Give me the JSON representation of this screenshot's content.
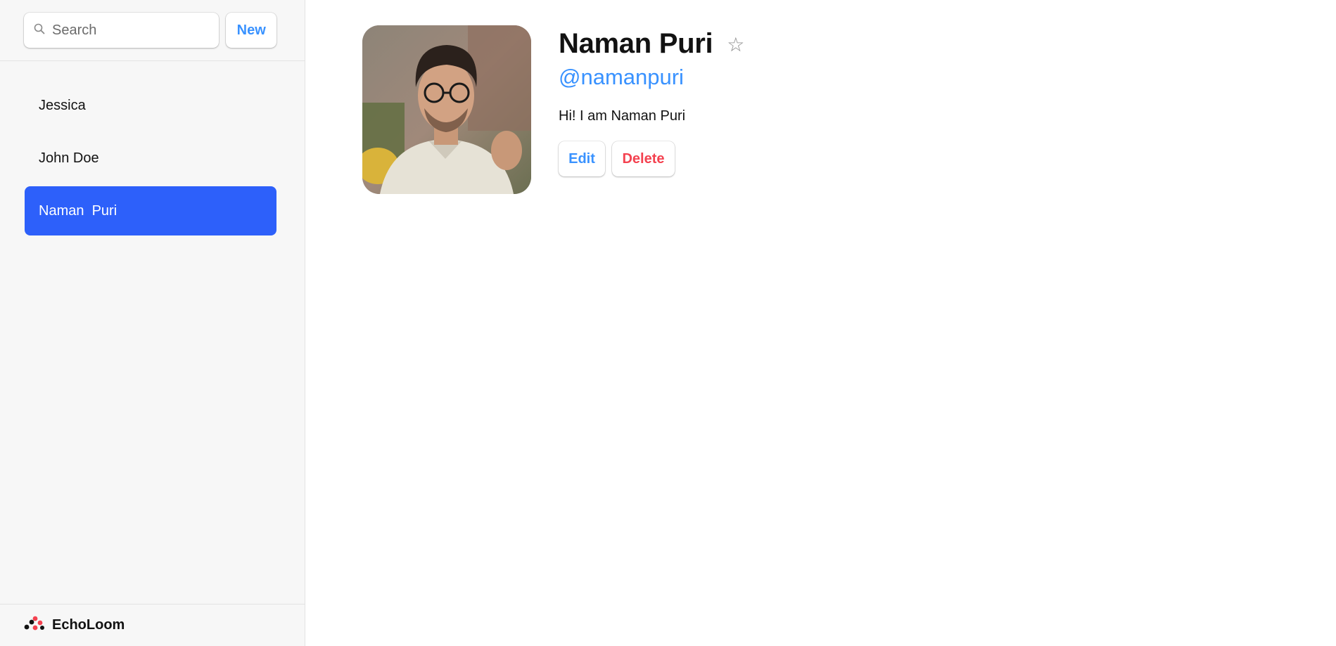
{
  "sidebar": {
    "search": {
      "placeholder": "Search",
      "icon": "search-icon"
    },
    "new_label": "New",
    "contacts": [
      {
        "label": "Jessica",
        "active": false
      },
      {
        "label": "John Doe",
        "active": false
      },
      {
        "label": "Naman  Puri",
        "active": true
      }
    ],
    "footer": {
      "brand": "EchoLoom",
      "icon": "echoloom-logo-icon"
    }
  },
  "contact": {
    "name": "Naman Puri",
    "favorite": false,
    "favorite_symbol": "☆",
    "handle": "@namanpuri",
    "bio": "Hi! I am Naman Puri",
    "edit_label": "Edit",
    "delete_label": "Delete"
  },
  "colors": {
    "accent": "#3992ff",
    "active_item": "#2d60fa",
    "danger": "#f44250",
    "sidebar_bg": "#f7f7f7"
  }
}
